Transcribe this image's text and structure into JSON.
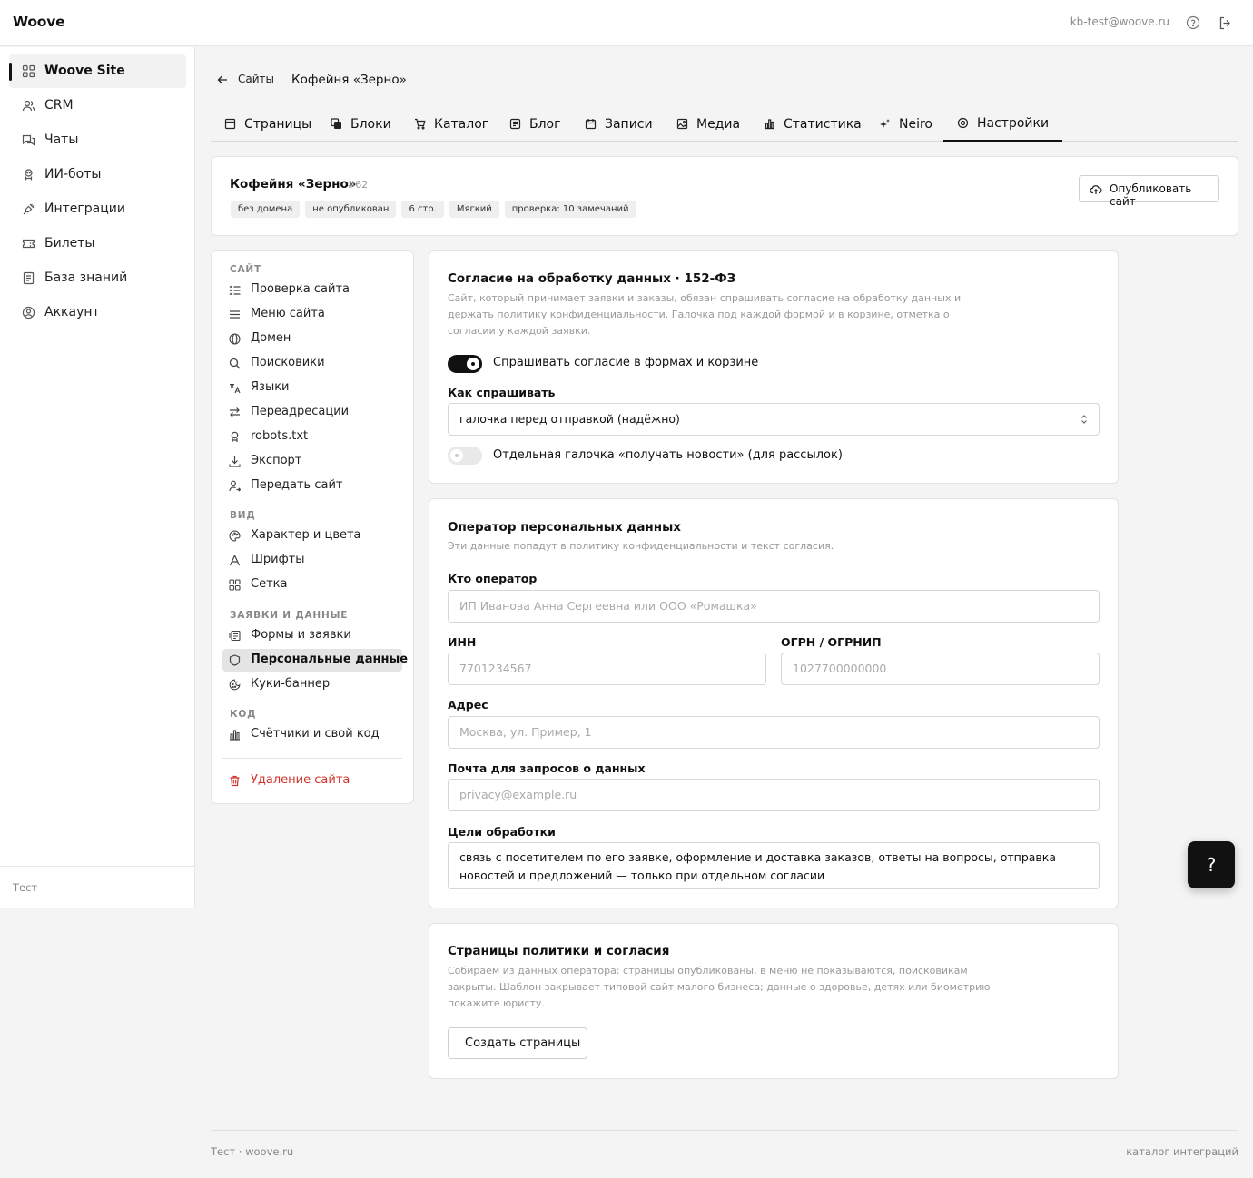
{
  "app": {
    "logo": "Woove",
    "user_email": "kb-test@woove.ru"
  },
  "leftnav": {
    "items": [
      {
        "label": "Woove Site",
        "icon": "grid-icon"
      },
      {
        "label": "CRM",
        "icon": "users-icon"
      },
      {
        "label": "Чаты",
        "icon": "chat-icon"
      },
      {
        "label": "ИИ-боты",
        "icon": "bot-icon"
      },
      {
        "label": "Интеграции",
        "icon": "plug-icon"
      },
      {
        "label": "Билеты",
        "icon": "ticket-icon"
      },
      {
        "label": "База знаний",
        "icon": "book-icon"
      },
      {
        "label": "Аккаунт",
        "icon": "user-circle-icon"
      }
    ],
    "footer": "Тест"
  },
  "breadcrumb": {
    "back_label": "Сайты",
    "current": "Кофейня «Зерно»"
  },
  "tabs": [
    {
      "label": "Страницы",
      "icon": "page-icon"
    },
    {
      "label": "Блоки",
      "icon": "blocks-icon"
    },
    {
      "label": "Каталог",
      "icon": "cart-icon"
    },
    {
      "label": "Блог",
      "icon": "blog-icon"
    },
    {
      "label": "Записи",
      "icon": "calendar-icon"
    },
    {
      "label": "Медиа",
      "icon": "image-icon"
    },
    {
      "label": "Статистика",
      "icon": "chart-icon"
    },
    {
      "label": "Neiro",
      "icon": "sparkle-icon"
    },
    {
      "label": "Настройки",
      "icon": "gear-icon",
      "active": true
    }
  ],
  "site": {
    "name": "Кофейня «Зерно»",
    "id": "#62",
    "badges": [
      "без домена",
      "не опубликован",
      "6 стр.",
      "Мягкий",
      "проверка: 10 замечаний"
    ],
    "publish_label": "Опубликовать сайт"
  },
  "settings_menu": {
    "sections": [
      {
        "title": "САЙТ",
        "items": [
          {
            "label": "Проверка сайта",
            "icon": "checklist-icon"
          },
          {
            "label": "Меню сайта",
            "icon": "menu-icon"
          },
          {
            "label": "Домен",
            "icon": "globe-icon"
          },
          {
            "label": "Поисковики",
            "icon": "search-icon"
          },
          {
            "label": "Языки",
            "icon": "translate-icon"
          },
          {
            "label": "Переадресации",
            "icon": "redirect-icon"
          },
          {
            "label": "robots.txt",
            "icon": "robot-icon"
          },
          {
            "label": "Экспорт",
            "icon": "download-icon"
          },
          {
            "label": "Передать сайт",
            "icon": "user-transfer-icon"
          }
        ]
      },
      {
        "title": "ВИД",
        "items": [
          {
            "label": "Характер и цвета",
            "icon": "palette-icon"
          },
          {
            "label": "Шрифты",
            "icon": "font-icon"
          },
          {
            "label": "Сетка",
            "icon": "grid-icon"
          }
        ]
      },
      {
        "title": "ЗАЯВКИ И ДАННЫЕ",
        "items": [
          {
            "label": "Формы и заявки",
            "icon": "form-icon"
          },
          {
            "label": "Персональные данные",
            "icon": "shield-icon",
            "active": true
          },
          {
            "label": "Куки-баннер",
            "icon": "cookie-icon"
          }
        ]
      },
      {
        "title": "КОД",
        "items": [
          {
            "label": "Счётчики и свой код",
            "icon": "bar-chart-icon"
          }
        ]
      }
    ],
    "delete_label": "Удаление сайта"
  },
  "consent": {
    "title": "Согласие на обработку данных · 152-ФЗ",
    "desc": "Сайт, который принимает заявки и заказы, обязан спрашивать согласие на обработку данных и держать политику конфиденциальности. Галочка под каждой формой и в корзине, отметка о согласии у каждой заявки.",
    "ask_toggle_label": "Спрашивать согласие в формах и корзине",
    "ask_toggle_on": true,
    "how_label": "Как спрашивать",
    "how_value": "галочка перед отправкой (надёжно)",
    "news_toggle_label": "Отдельная галочка «получать новости» (для рассылок)",
    "news_toggle_on": false
  },
  "operator": {
    "title": "Оператор персональных данных",
    "desc": "Эти данные попадут в политику конфиденциальности и текст согласия.",
    "who_label": "Кто оператор",
    "who_placeholder": "ИП Иванова Анна Сергеевна или ООО «Ромашка»",
    "inn_label": "ИНН",
    "inn_placeholder": "7701234567",
    "ogrn_label": "ОГРН / ОГРНИП",
    "ogrn_placeholder": "1027700000000",
    "address_label": "Адрес",
    "address_placeholder": "Москва, ул. Пример, 1",
    "email_label": "Почта для запросов о данных",
    "email_placeholder": "privacy@example.ru",
    "goals_label": "Цели обработки",
    "goals_value": "связь с посетителем по его заявке, оформление и доставка заказов, ответы на вопросы, отправка новостей и предложений — только при отдельном согласии"
  },
  "policy": {
    "title": "Страницы политики и согласия",
    "desc": "Собираем из данных оператора: страницы опубликованы, в меню не показываются, поисковикам закрыты. Шаблон закрывает типовой сайт малого бизнеса; данные о здоровье, детях или биометрию покажите юристу.",
    "create_label": "Создать страницы"
  },
  "fab_label": "?",
  "footer": {
    "left": "Тест · woove.ru",
    "right": "каталог интеграций"
  }
}
